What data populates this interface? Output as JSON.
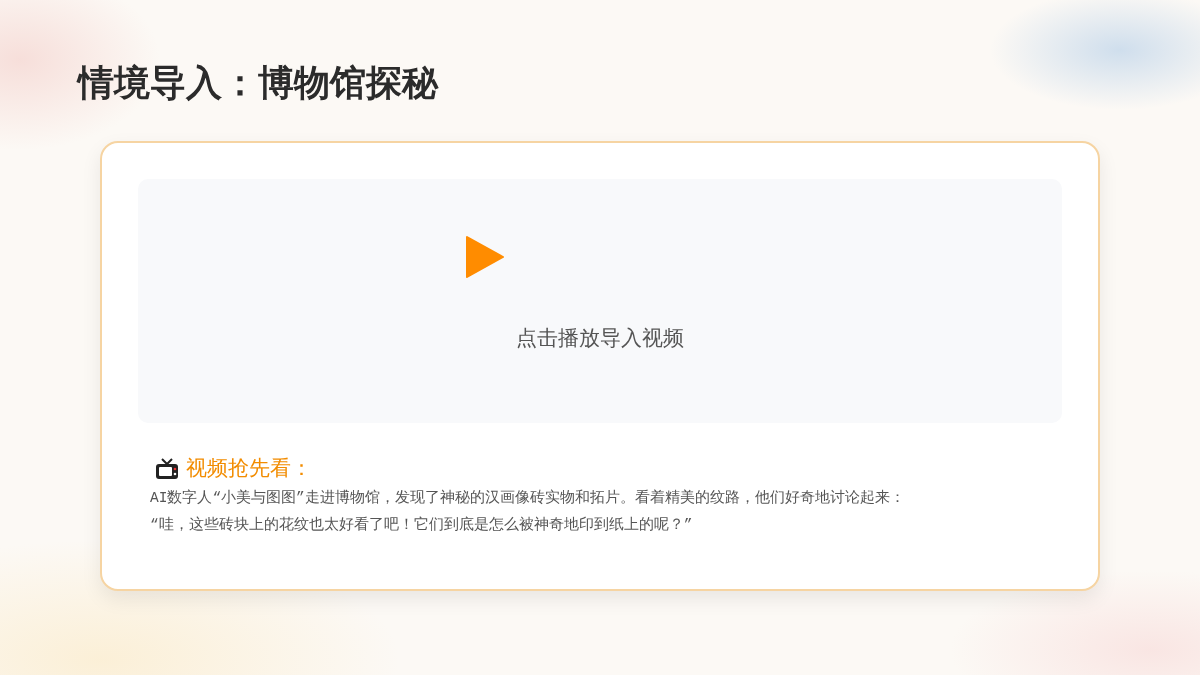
{
  "title": "情境导入：博物馆探秘",
  "video": {
    "prompt": "点击播放导入视频"
  },
  "preview": {
    "heading": "视频抢先看：",
    "paragraphs": [
      "AI数字人“小美与图图”走进博物馆，发现了神秘的汉画像砖实物和拓片。看着精美的纹路，他们好奇地讨论起来：",
      "“哇，这些砖块上的花纹也太好看了吧！它们到底是怎么被神奇地印到纸上的呢？”"
    ]
  }
}
